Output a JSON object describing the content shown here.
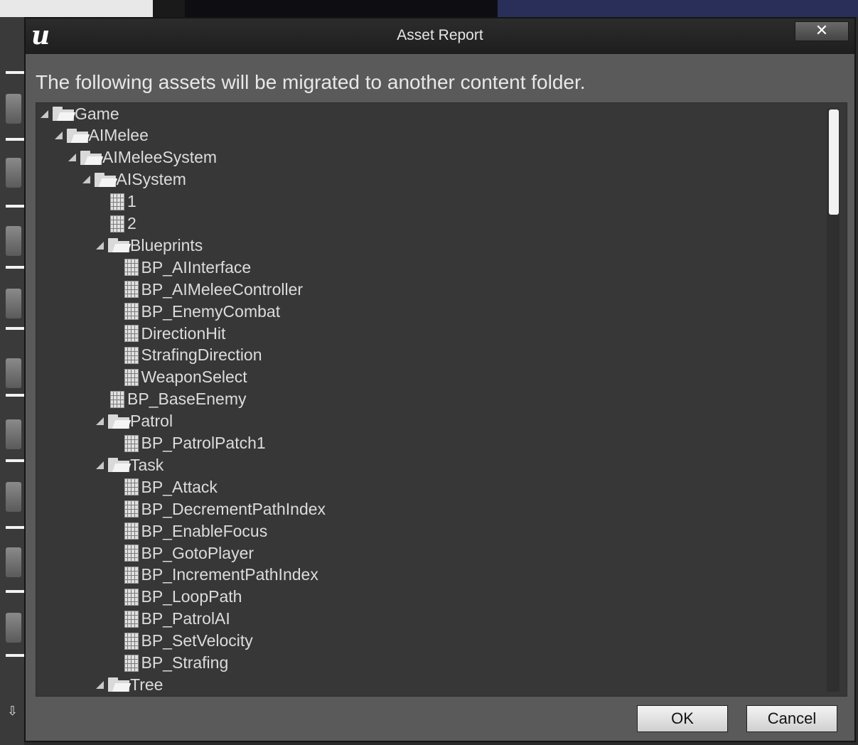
{
  "dialog": {
    "title": "Asset Report",
    "close_glyph": "✕",
    "logo_glyph": "u",
    "message": "The following assets will be migrated to another content folder."
  },
  "tree": [
    {
      "label": "Game",
      "kind": "folder",
      "depth": 0,
      "expanded": true
    },
    {
      "label": "AIMelee",
      "kind": "folder",
      "depth": 1,
      "expanded": true
    },
    {
      "label": "AIMeleeSystem",
      "kind": "folder",
      "depth": 2,
      "expanded": true
    },
    {
      "label": "AISystem",
      "kind": "folder",
      "depth": 3,
      "expanded": true
    },
    {
      "label": "1",
      "kind": "file",
      "depth": 4
    },
    {
      "label": "2",
      "kind": "file",
      "depth": 4
    },
    {
      "label": "Blueprints",
      "kind": "folder",
      "depth": 4,
      "expanded": true
    },
    {
      "label": "BP_AIInterface",
      "kind": "file",
      "depth": 5
    },
    {
      "label": "BP_AIMeleeController",
      "kind": "file",
      "depth": 5
    },
    {
      "label": "BP_EnemyCombat",
      "kind": "file",
      "depth": 5
    },
    {
      "label": "DirectionHit",
      "kind": "file",
      "depth": 5
    },
    {
      "label": "StrafingDirection",
      "kind": "file",
      "depth": 5
    },
    {
      "label": "WeaponSelect",
      "kind": "file",
      "depth": 5
    },
    {
      "label": "BP_BaseEnemy",
      "kind": "file",
      "depth": 4
    },
    {
      "label": "Patrol",
      "kind": "folder",
      "depth": 4,
      "expanded": true
    },
    {
      "label": "BP_PatrolPatch1",
      "kind": "file",
      "depth": 5
    },
    {
      "label": "Task",
      "kind": "folder",
      "depth": 4,
      "expanded": true
    },
    {
      "label": "BP_Attack",
      "kind": "file",
      "depth": 5
    },
    {
      "label": "BP_DecrementPathIndex",
      "kind": "file",
      "depth": 5
    },
    {
      "label": "BP_EnableFocus",
      "kind": "file",
      "depth": 5
    },
    {
      "label": "BP_GotoPlayer",
      "kind": "file",
      "depth": 5
    },
    {
      "label": "BP_IncrementPathIndex",
      "kind": "file",
      "depth": 5
    },
    {
      "label": "BP_LoopPath",
      "kind": "file",
      "depth": 5
    },
    {
      "label": "BP_PatrolAI",
      "kind": "file",
      "depth": 5
    },
    {
      "label": "BP_SetVelocity",
      "kind": "file",
      "depth": 5
    },
    {
      "label": "BP_Strafing",
      "kind": "file",
      "depth": 5
    },
    {
      "label": "Tree",
      "kind": "folder",
      "depth": 4,
      "expanded": true
    }
  ],
  "buttons": {
    "ok": "OK",
    "cancel": "Cancel"
  },
  "icons": {
    "folder": "folder-icon",
    "file": "blueprint-asset-icon",
    "expand": "expanded-arrow-icon"
  }
}
